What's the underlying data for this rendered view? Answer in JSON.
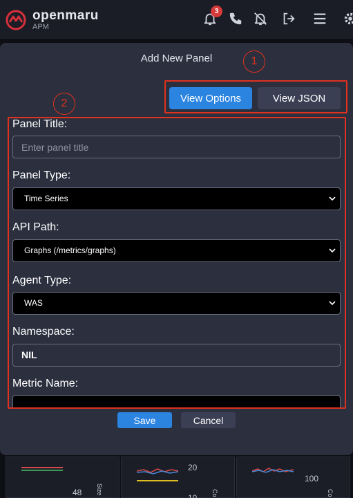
{
  "header": {
    "brand_name": "openmaru",
    "brand_sub": "APM",
    "notification_count": "3",
    "icons": [
      "bell-icon",
      "phone-icon",
      "bell-off-icon",
      "logout-icon",
      "menu-icon",
      "gear-icon"
    ]
  },
  "modal": {
    "title": "Add New Panel",
    "tabs": {
      "view_options": "View Options",
      "view_json": "View JSON"
    },
    "fields": {
      "panel_title": {
        "label": "Panel Title:",
        "placeholder": "Enter panel title",
        "value": ""
      },
      "panel_type": {
        "label": "Panel Type:",
        "selected": "Time Series"
      },
      "api_path": {
        "label": "API Path:",
        "selected": "Graphs (/metrics/graphs)"
      },
      "agent_type": {
        "label": "Agent Type:",
        "selected": "WAS"
      },
      "namespace": {
        "label": "Namespace:",
        "value": "NIL"
      },
      "metric_name": {
        "label": "Metric Name:"
      }
    },
    "buttons": {
      "save": "Save",
      "cancel": "Cancel"
    }
  },
  "annotations": {
    "one": "1",
    "two": "2"
  },
  "background": {
    "values": [
      "48",
      "20",
      "10",
      "100"
    ],
    "side_labels": [
      "Size",
      "Co",
      "Co"
    ]
  },
  "colors": {
    "accent": "#2a84e0",
    "callout": "#e0321e",
    "modal_bg": "#2b2f3e"
  }
}
